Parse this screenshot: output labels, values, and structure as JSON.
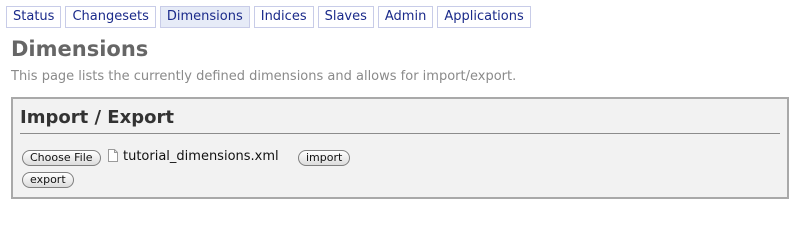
{
  "nav": {
    "tabs": [
      {
        "label": "Status"
      },
      {
        "label": "Changesets"
      },
      {
        "label": "Dimensions",
        "active": true
      },
      {
        "label": "Indices"
      },
      {
        "label": "Slaves"
      },
      {
        "label": "Admin"
      },
      {
        "label": "Applications"
      }
    ]
  },
  "page": {
    "title": "Dimensions",
    "description": "This page lists the currently defined dimensions and allows for import/export."
  },
  "import_export": {
    "title": "Import / Export",
    "choose_file_label": "Choose File",
    "file_icon": "document-icon",
    "file_name": "tutorial_dimensions.xml",
    "import_label": "import",
    "export_label": "export"
  },
  "colors": {
    "tab_text": "#1a2a8a",
    "tab_border": "#c8cce8",
    "active_tab_bg": "#e6ebf7",
    "title_gray": "#666666",
    "panel_bg": "#f2f2f2",
    "panel_border": "#a9a9a9"
  }
}
